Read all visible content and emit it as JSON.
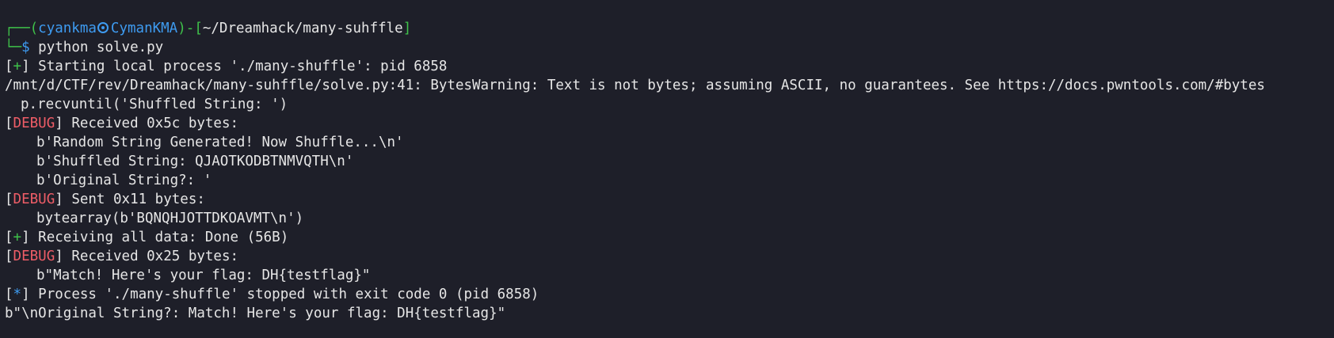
{
  "prompt": {
    "corner_top": "┌──",
    "user": "cyankma",
    "user_host_icon": "skull-icon",
    "host": "CymanKMA",
    "bracket_open": "(",
    "bracket_close": ")",
    "dash": "-",
    "dir_open": "[",
    "path": "~/Dreamhack/many-suhffle",
    "dir_close": "]",
    "corner_bottom": "└─",
    "dollar": "$",
    "command": "python solve.py"
  },
  "output": {
    "l1_open": "[",
    "l1_sym": "+",
    "l1_close": "]",
    "l1_text": " Starting local process './many-shuffle': pid 6858",
    "l2_text": "/mnt/d/CTF/rev/Dreamhack/many-suhffle/solve.py:41: BytesWarning: Text is not bytes; assuming ASCII, no guarantees. See https://docs.pwntools.com/#bytes",
    "l3_text": "p.recvuntil('Shuffled String: ')",
    "l4_open": "[",
    "l4_tag": "DEBUG",
    "l4_close": "]",
    "l4_text": " Received 0x5c bytes:",
    "l5_text": "b'Random String Generated! Now Shuffle...\\n'",
    "l6_text": "b'Shuffled String: QJAOTKODBTNMVQTH\\n'",
    "l7_text": "b'Original String?: '",
    "l8_open": "[",
    "l8_tag": "DEBUG",
    "l8_close": "]",
    "l8_text": " Sent 0x11 bytes:",
    "l9_text": "bytearray(b'BQNQHJOTTDKOAVMT\\n')",
    "l10_open": "[",
    "l10_sym": "+",
    "l10_close": "]",
    "l10_text": " Receiving all data: Done (56B)",
    "l11_open": "[",
    "l11_tag": "DEBUG",
    "l11_close": "]",
    "l11_text": " Received 0x25 bytes:",
    "l12_text": "b\"Match! Here's your flag: DH{testflag}\"",
    "l13_open": "[",
    "l13_sym": "*",
    "l13_close": "]",
    "l13_text": " Process './many-shuffle' stopped with exit code 0 (pid 6858)",
    "l14_text": "b\"\\nOriginal String?: Match! Here's your flag: DH{testflag}\""
  },
  "colors": {
    "background": "#1e1f29",
    "text": "#e6e6e6",
    "prompt_green": "#3fc24a",
    "prompt_blue": "#3e9bf0",
    "debug_red": "#ef5d67"
  }
}
